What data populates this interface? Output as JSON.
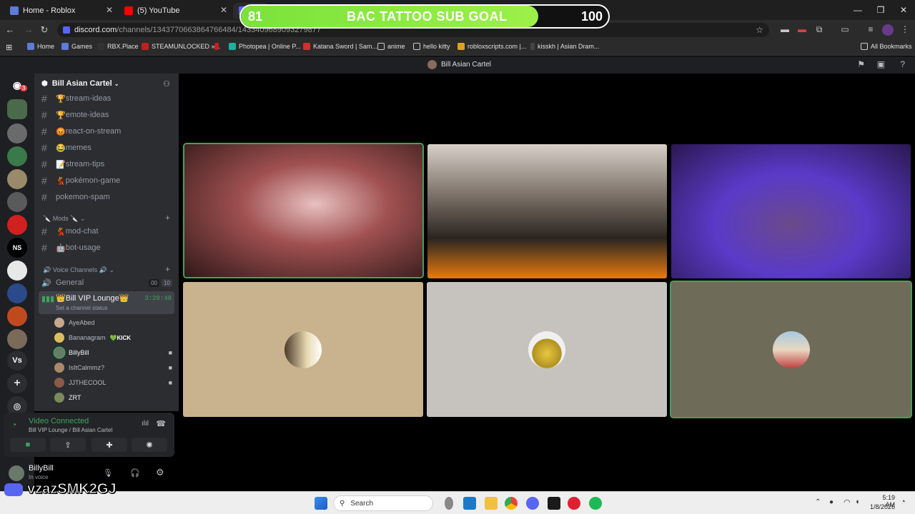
{
  "browser": {
    "tabs": [
      {
        "title": "Home - Roblox"
      },
      {
        "title": "(5) YouTube"
      }
    ],
    "url_domain": "discord.com",
    "url_path": "/channels/1343770663864766484/1433409689093279877",
    "bookmarks": [
      "Home",
      "Games",
      "RBX.Place",
      "STEAMUNLOCKED »...",
      "Photopea | Online P...",
      "Katana Sword | Sam...",
      "anime",
      "hello kitty",
      "robloxscripts.com |...",
      "kisskh | Asian Dram..."
    ],
    "all_bookmarks": "All Bookmarks"
  },
  "goal_overlay": {
    "current": "81",
    "label": "BAC TATTOO SUB GOAL",
    "target": "100",
    "progress_fraction": 0.81
  },
  "discord": {
    "window_title": "Bill Asian Cartel",
    "server_name": "Bill Asian Cartel",
    "server_badge": "3",
    "channels": [
      {
        "name": "stream-ideas",
        "emoji": "🏆"
      },
      {
        "name": "emote-ideas",
        "emoji": "🏆"
      },
      {
        "name": "react-on-stream",
        "emoji": "😡"
      },
      {
        "name": "memes",
        "emoji": "😂"
      },
      {
        "name": "stream-tips",
        "emoji": "📝"
      },
      {
        "name": "pokémon-game",
        "emoji": "💃"
      },
      {
        "name": "pokemon-spam",
        "emoji": ""
      }
    ],
    "mods_category": "Mods",
    "mod_channels": [
      {
        "name": "mod-chat",
        "emoji": "💃"
      },
      {
        "name": "bot-usage",
        "emoji": "🤖"
      }
    ],
    "voice_category": "Voice Channels",
    "voice_general": {
      "name": "General",
      "count_a": "00",
      "count_b": "10"
    },
    "vip_lounge": {
      "name": "Bill VIP Lounge",
      "timer": "3:20:48",
      "status": "Set a channel status"
    },
    "voice_users": [
      {
        "name": "AyeAbed",
        "tag": "",
        "cam": false
      },
      {
        "name": "Bananagram",
        "tag": "KICK",
        "cam": false
      },
      {
        "name": "BillyBill",
        "tag": "",
        "cam": true
      },
      {
        "name": "IsItCalmmz?",
        "tag": "",
        "cam": true
      },
      {
        "name": "JJTHECOOL",
        "tag": "",
        "cam": true
      },
      {
        "name": "ZRT",
        "tag": "",
        "cam": false
      }
    ],
    "vc_status": "Video Connected",
    "vc_location": "Bill VIP Lounge / Bill Asian Cartel",
    "user_name": "BillyBill",
    "user_status": "In voice"
  },
  "watermark": "vzazSMK2GJ",
  "taskbar": {
    "search_placeholder": "Search",
    "time": "5:19 AM",
    "date": "1/8/2026"
  },
  "colors": {
    "accent_green": "#3ba55c",
    "goal_green": "#8be83f",
    "discord_bg": "#2b2d31"
  }
}
